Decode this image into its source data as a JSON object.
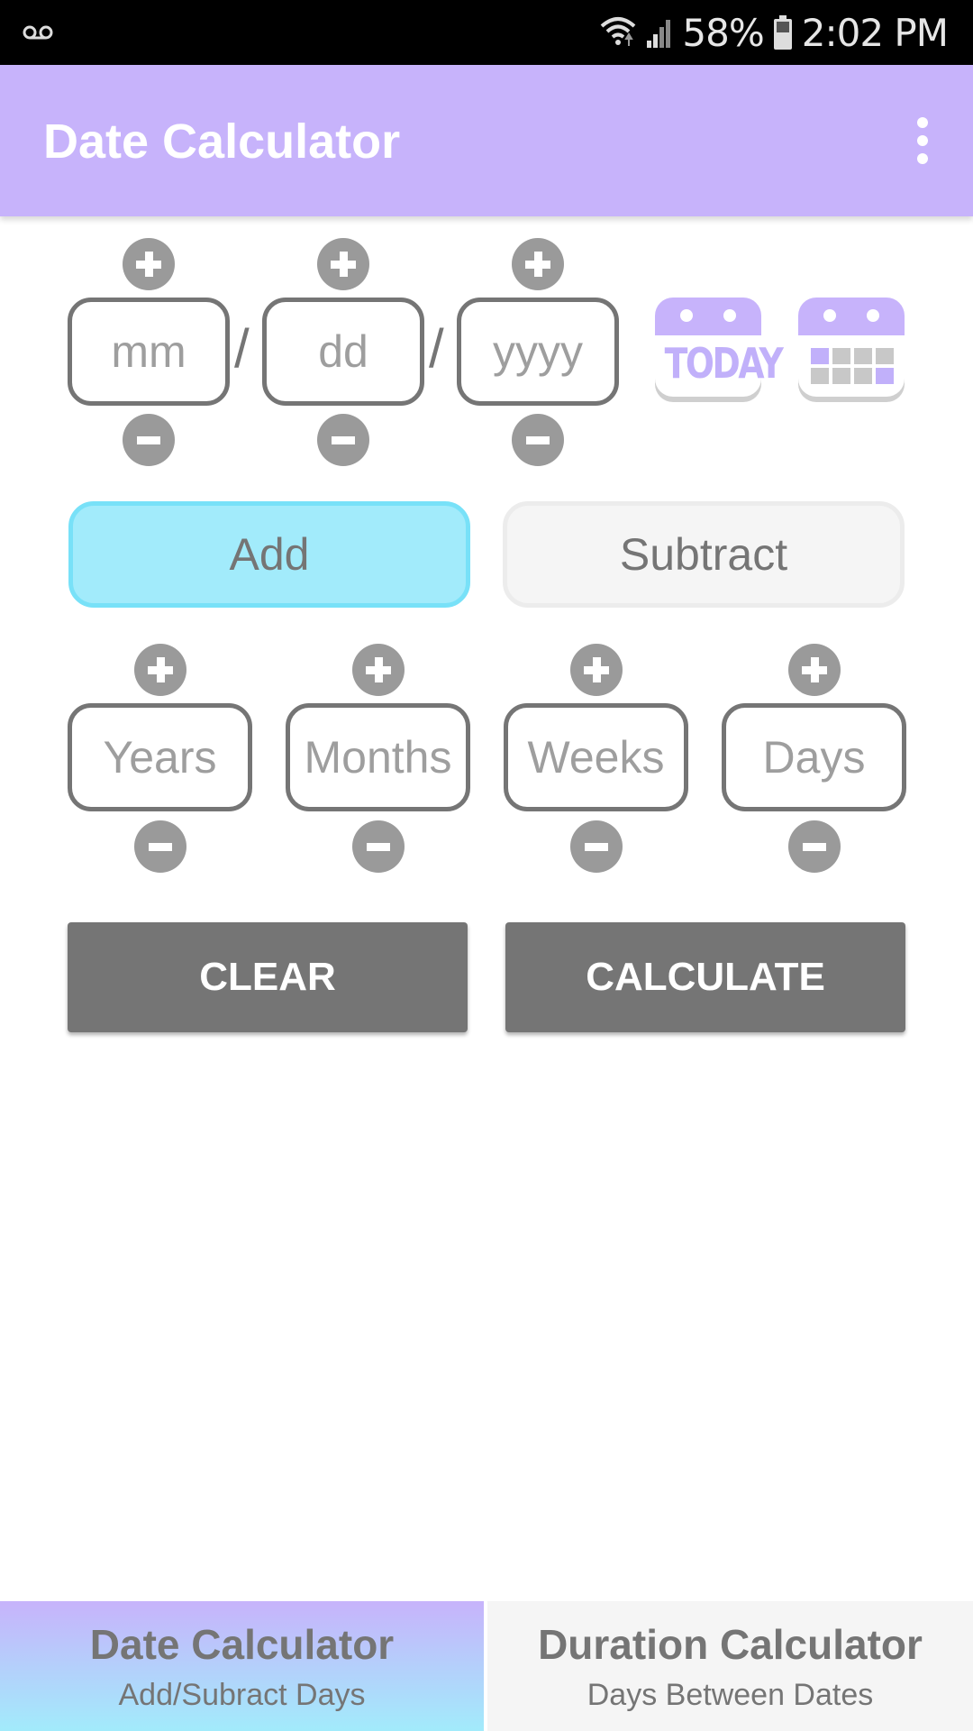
{
  "status_bar": {
    "voicemail_icon": "voicemail-icon",
    "wifi_icon": "wifi-icon",
    "signal_icon": "signal-icon",
    "battery_percent": "58%",
    "battery_icon": "battery-icon",
    "time": "2:02 PM"
  },
  "app_bar": {
    "title": "Date Calculator",
    "menu_icon": "more-vert-icon"
  },
  "date_input": {
    "month_placeholder": "mm",
    "day_placeholder": "dd",
    "year_placeholder": "yyyy",
    "separator": "/",
    "today_button_label": "TODAY",
    "calendar_button_icon": "calendar-grid-icon"
  },
  "mode": {
    "add_label": "Add",
    "subtract_label": "Subtract",
    "selected": "Add"
  },
  "duration_inputs": [
    {
      "placeholder": "Years"
    },
    {
      "placeholder": "Months"
    },
    {
      "placeholder": "Weeks"
    },
    {
      "placeholder": "Days"
    }
  ],
  "actions": {
    "clear_label": "CLEAR",
    "calculate_label": "CALCULATE"
  },
  "bottom_nav": [
    {
      "title": "Date Calculator",
      "subtitle": "Add/Subract Days",
      "active": true
    },
    {
      "title": "Duration Calculator",
      "subtitle": "Days Between Dates",
      "active": false
    }
  ],
  "colors": {
    "accent_purple": "#c7b3fb",
    "accent_cyan": "#a2ebfb",
    "button_gray": "#757575"
  }
}
